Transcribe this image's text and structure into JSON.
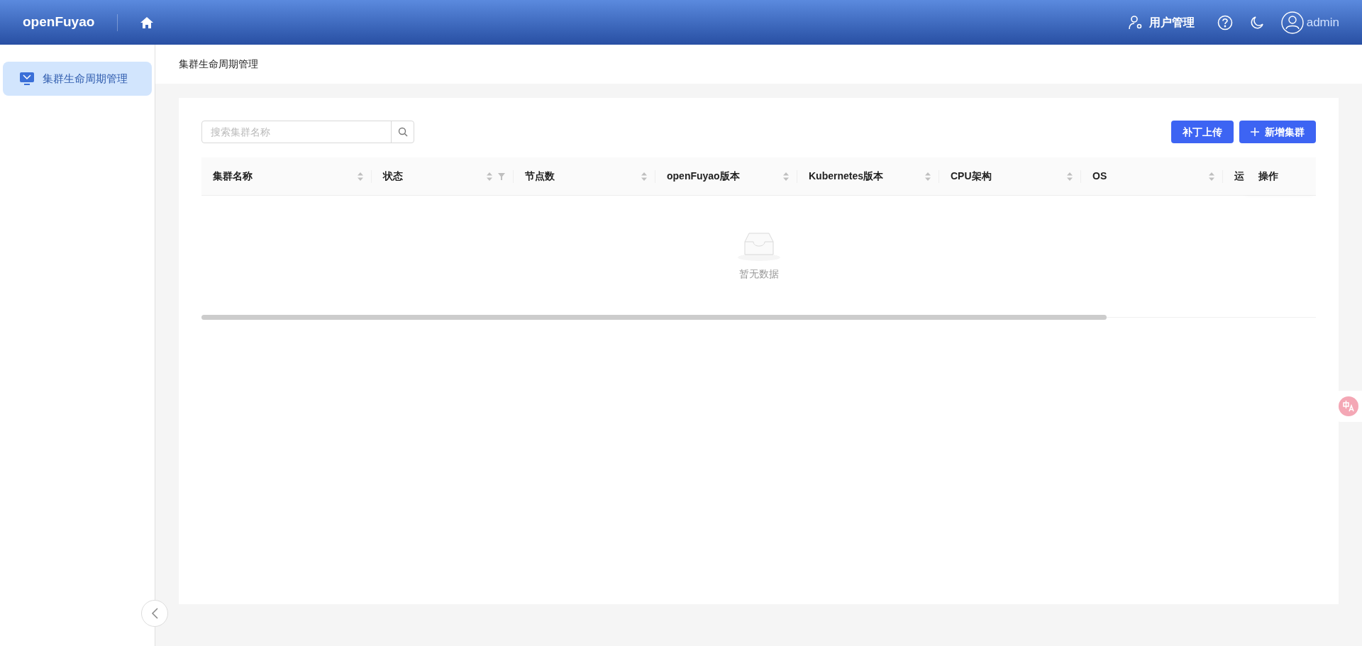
{
  "header": {
    "logo": "openFuyao",
    "user_management": "用户管理",
    "username": "admin"
  },
  "sidebar": {
    "items": [
      {
        "label": "集群生命周期管理",
        "selected": true
      }
    ]
  },
  "breadcrumb": "集群生命周期管理",
  "toolbar": {
    "search_placeholder": "搜索集群名称",
    "buttons": [
      {
        "label": "补丁上传",
        "kind": "plain"
      },
      {
        "label": "新增集群",
        "kind": "add"
      }
    ]
  },
  "table": {
    "columns": [
      {
        "label": "集群名称",
        "sortable": true,
        "filterable": false
      },
      {
        "label": "状态",
        "sortable": true,
        "filterable": true
      },
      {
        "label": "节点数",
        "sortable": true,
        "filterable": false
      },
      {
        "label": "openFuyao版本",
        "sortable": true,
        "filterable": false
      },
      {
        "label": "Kubernetes版本",
        "sortable": true,
        "filterable": false
      },
      {
        "label": "CPU架构",
        "sortable": true,
        "filterable": false
      },
      {
        "label": "OS",
        "sortable": true,
        "filterable": false
      },
      {
        "label": "运"
      }
    ],
    "action_column": "操作",
    "empty_text": "暂无数据"
  }
}
